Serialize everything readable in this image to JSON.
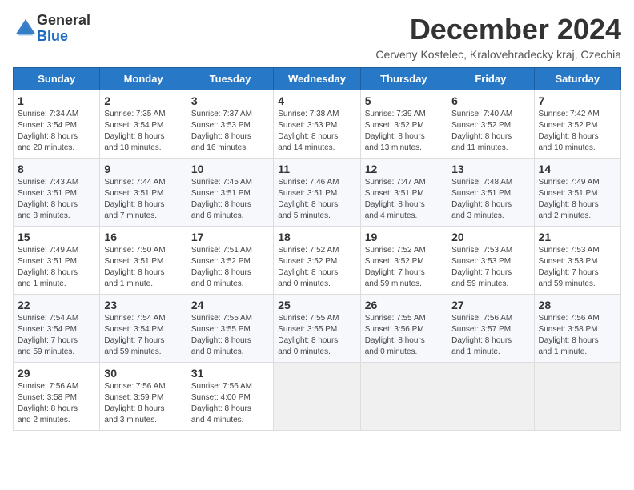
{
  "logo": {
    "general": "General",
    "blue": "Blue"
  },
  "title": "December 2024",
  "subtitle": "Cerveny Kostelec, Kralovehradecky kraj, Czechia",
  "headers": [
    "Sunday",
    "Monday",
    "Tuesday",
    "Wednesday",
    "Thursday",
    "Friday",
    "Saturday"
  ],
  "weeks": [
    [
      {
        "day": "1",
        "info": "Sunrise: 7:34 AM\nSunset: 3:54 PM\nDaylight: 8 hours\nand 20 minutes."
      },
      {
        "day": "2",
        "info": "Sunrise: 7:35 AM\nSunset: 3:54 PM\nDaylight: 8 hours\nand 18 minutes."
      },
      {
        "day": "3",
        "info": "Sunrise: 7:37 AM\nSunset: 3:53 PM\nDaylight: 8 hours\nand 16 minutes."
      },
      {
        "day": "4",
        "info": "Sunrise: 7:38 AM\nSunset: 3:53 PM\nDaylight: 8 hours\nand 14 minutes."
      },
      {
        "day": "5",
        "info": "Sunrise: 7:39 AM\nSunset: 3:52 PM\nDaylight: 8 hours\nand 13 minutes."
      },
      {
        "day": "6",
        "info": "Sunrise: 7:40 AM\nSunset: 3:52 PM\nDaylight: 8 hours\nand 11 minutes."
      },
      {
        "day": "7",
        "info": "Sunrise: 7:42 AM\nSunset: 3:52 PM\nDaylight: 8 hours\nand 10 minutes."
      }
    ],
    [
      {
        "day": "8",
        "info": "Sunrise: 7:43 AM\nSunset: 3:51 PM\nDaylight: 8 hours\nand 8 minutes."
      },
      {
        "day": "9",
        "info": "Sunrise: 7:44 AM\nSunset: 3:51 PM\nDaylight: 8 hours\nand 7 minutes."
      },
      {
        "day": "10",
        "info": "Sunrise: 7:45 AM\nSunset: 3:51 PM\nDaylight: 8 hours\nand 6 minutes."
      },
      {
        "day": "11",
        "info": "Sunrise: 7:46 AM\nSunset: 3:51 PM\nDaylight: 8 hours\nand 5 minutes."
      },
      {
        "day": "12",
        "info": "Sunrise: 7:47 AM\nSunset: 3:51 PM\nDaylight: 8 hours\nand 4 minutes."
      },
      {
        "day": "13",
        "info": "Sunrise: 7:48 AM\nSunset: 3:51 PM\nDaylight: 8 hours\nand 3 minutes."
      },
      {
        "day": "14",
        "info": "Sunrise: 7:49 AM\nSunset: 3:51 PM\nDaylight: 8 hours\nand 2 minutes."
      }
    ],
    [
      {
        "day": "15",
        "info": "Sunrise: 7:49 AM\nSunset: 3:51 PM\nDaylight: 8 hours\nand 1 minute."
      },
      {
        "day": "16",
        "info": "Sunrise: 7:50 AM\nSunset: 3:51 PM\nDaylight: 8 hours\nand 1 minute."
      },
      {
        "day": "17",
        "info": "Sunrise: 7:51 AM\nSunset: 3:52 PM\nDaylight: 8 hours\nand 0 minutes."
      },
      {
        "day": "18",
        "info": "Sunrise: 7:52 AM\nSunset: 3:52 PM\nDaylight: 8 hours\nand 0 minutes."
      },
      {
        "day": "19",
        "info": "Sunrise: 7:52 AM\nSunset: 3:52 PM\nDaylight: 7 hours\nand 59 minutes."
      },
      {
        "day": "20",
        "info": "Sunrise: 7:53 AM\nSunset: 3:53 PM\nDaylight: 7 hours\nand 59 minutes."
      },
      {
        "day": "21",
        "info": "Sunrise: 7:53 AM\nSunset: 3:53 PM\nDaylight: 7 hours\nand 59 minutes."
      }
    ],
    [
      {
        "day": "22",
        "info": "Sunrise: 7:54 AM\nSunset: 3:54 PM\nDaylight: 7 hours\nand 59 minutes."
      },
      {
        "day": "23",
        "info": "Sunrise: 7:54 AM\nSunset: 3:54 PM\nDaylight: 7 hours\nand 59 minutes."
      },
      {
        "day": "24",
        "info": "Sunrise: 7:55 AM\nSunset: 3:55 PM\nDaylight: 8 hours\nand 0 minutes."
      },
      {
        "day": "25",
        "info": "Sunrise: 7:55 AM\nSunset: 3:55 PM\nDaylight: 8 hours\nand 0 minutes."
      },
      {
        "day": "26",
        "info": "Sunrise: 7:55 AM\nSunset: 3:56 PM\nDaylight: 8 hours\nand 0 minutes."
      },
      {
        "day": "27",
        "info": "Sunrise: 7:56 AM\nSunset: 3:57 PM\nDaylight: 8 hours\nand 1 minute."
      },
      {
        "day": "28",
        "info": "Sunrise: 7:56 AM\nSunset: 3:58 PM\nDaylight: 8 hours\nand 1 minute."
      }
    ],
    [
      {
        "day": "29",
        "info": "Sunrise: 7:56 AM\nSunset: 3:58 PM\nDaylight: 8 hours\nand 2 minutes."
      },
      {
        "day": "30",
        "info": "Sunrise: 7:56 AM\nSunset: 3:59 PM\nDaylight: 8 hours\nand 3 minutes."
      },
      {
        "day": "31",
        "info": "Sunrise: 7:56 AM\nSunset: 4:00 PM\nDaylight: 8 hours\nand 4 minutes."
      },
      {
        "day": "",
        "info": ""
      },
      {
        "day": "",
        "info": ""
      },
      {
        "day": "",
        "info": ""
      },
      {
        "day": "",
        "info": ""
      }
    ]
  ]
}
